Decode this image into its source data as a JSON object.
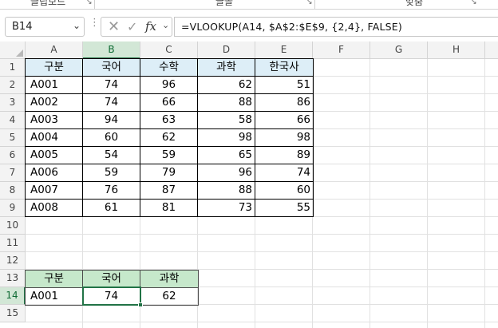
{
  "ribbon": {
    "groups": [
      "클립보드",
      "글꼴",
      "맞춤"
    ]
  },
  "formula_bar": {
    "name_box": "B14",
    "formula": "=VLOOKUP(A14, $A$2:$E$9, {2,4}, FALSE)",
    "icons": [
      "cancel-icon",
      "enter-icon",
      "insert-function-icon"
    ]
  },
  "sheet": {
    "columns": [
      "A",
      "B",
      "C",
      "D",
      "E",
      "F",
      "G",
      "H"
    ],
    "rows": [
      "1",
      "2",
      "3",
      "4",
      "5",
      "6",
      "7",
      "8",
      "9",
      "10",
      "11",
      "12",
      "13",
      "14",
      "15"
    ],
    "active_cell": "B14",
    "main_table": {
      "headers": [
        "구분",
        "국어",
        "수학",
        "과학",
        "한국사"
      ],
      "rows": [
        [
          "A001",
          "74",
          "96",
          "62",
          "51"
        ],
        [
          "A002",
          "74",
          "66",
          "88",
          "86"
        ],
        [
          "A003",
          "94",
          "63",
          "58",
          "66"
        ],
        [
          "A004",
          "60",
          "62",
          "98",
          "98"
        ],
        [
          "A005",
          "54",
          "59",
          "65",
          "89"
        ],
        [
          "A006",
          "59",
          "79",
          "96",
          "74"
        ],
        [
          "A007",
          "76",
          "87",
          "88",
          "60"
        ],
        [
          "A008",
          "61",
          "81",
          "73",
          "55"
        ]
      ]
    },
    "lookup_table": {
      "headers": [
        "구분",
        "국어",
        "과학"
      ],
      "row": [
        "A001",
        "74",
        "62"
      ]
    }
  },
  "colors": {
    "accent": "#217346",
    "header_blue": "#ddeef7",
    "header_green": "#c6e8cb"
  }
}
